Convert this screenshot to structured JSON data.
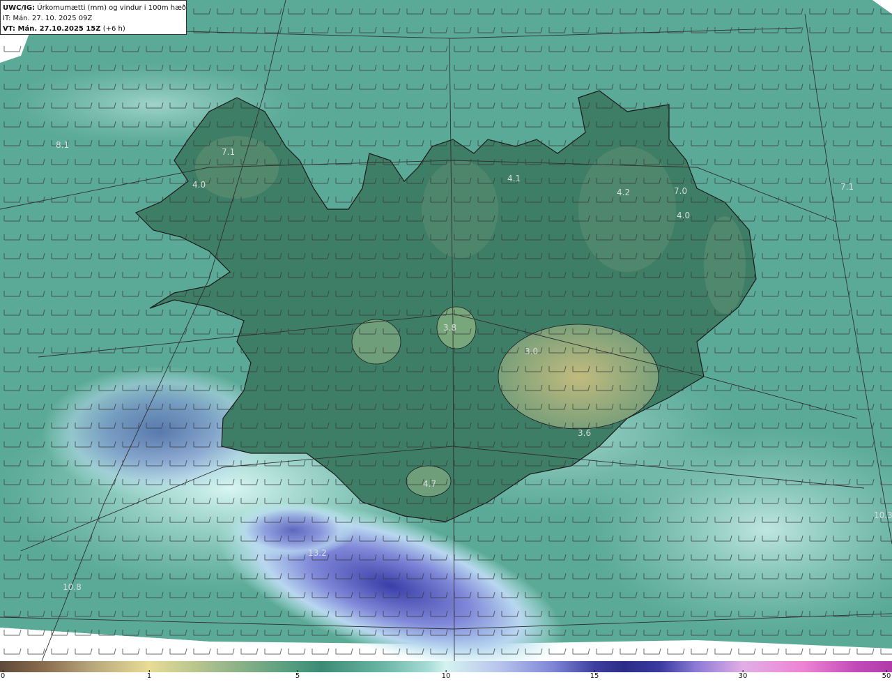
{
  "header": {
    "product": "UWC/IG:",
    "title": " Úrkomumætti (mm) og vindur i 100m hæð",
    "init_time": "IT: Mán. 27. 10. 2025 09Z",
    "valid_time": "VT: Mán. 27.10.2025 15Z",
    "lead": " (+6 h)"
  },
  "colors": {
    "sea": "#5aa896",
    "land_low": "#3f7f68",
    "land_high": "#9fb27a",
    "precip_light": "#c8f0ee",
    "precip_heavy": "#3a3fa8",
    "coast": "#1a1a1a"
  },
  "value_labels": [
    {
      "text": "8.1"
    },
    {
      "text": "7.1"
    },
    {
      "text": "4.0"
    },
    {
      "text": "4.1"
    },
    {
      "text": "4.2"
    },
    {
      "text": "7.0"
    },
    {
      "text": "4.0"
    },
    {
      "text": "7.1"
    },
    {
      "text": "3.8"
    },
    {
      "text": "3.0"
    },
    {
      "text": "3.6"
    },
    {
      "text": "4.7"
    },
    {
      "text": "13.2"
    },
    {
      "text": "10.3"
    },
    {
      "text": "10.8"
    }
  ],
  "colorbar": {
    "ticks": [
      "0",
      "1",
      "5",
      "10",
      "15",
      "30",
      "50"
    ]
  }
}
